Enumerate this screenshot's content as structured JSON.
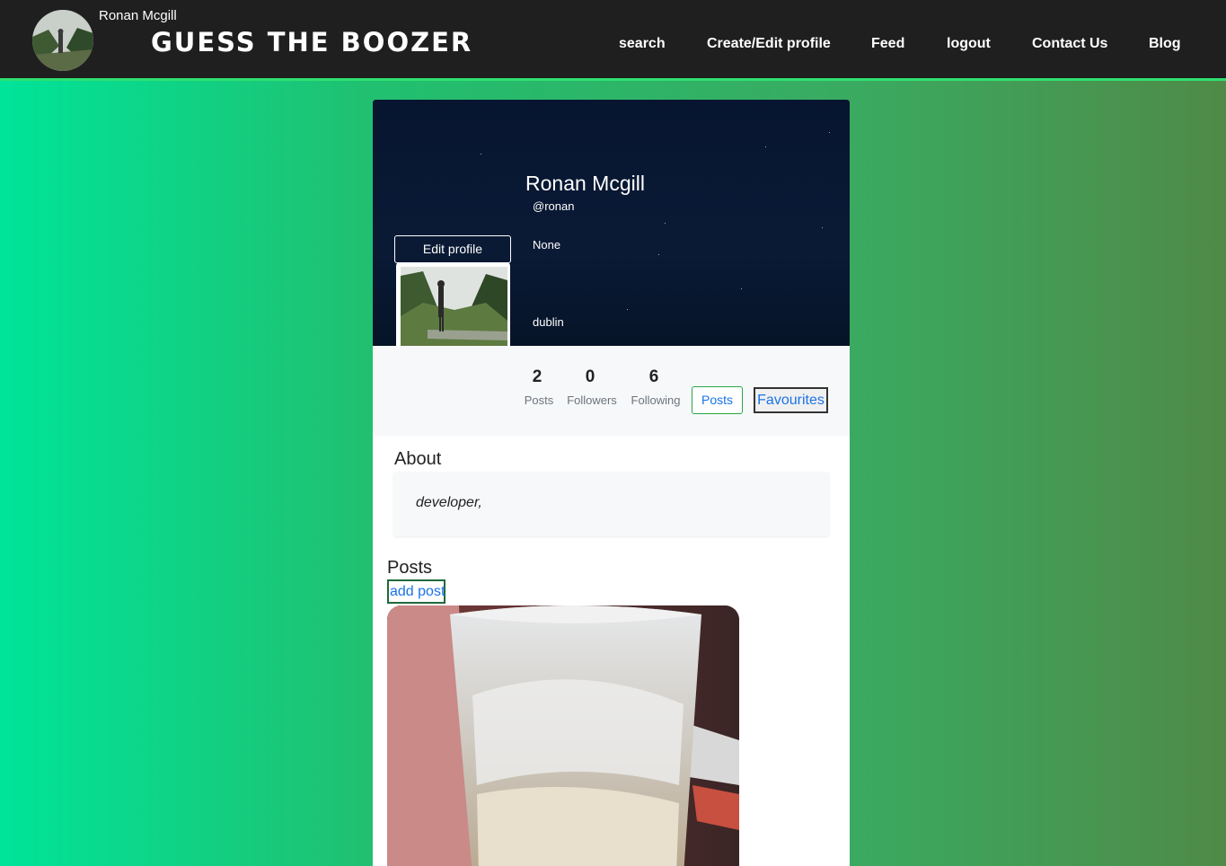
{
  "header": {
    "user_name": "Ronan Mcgill",
    "site_title": "GUESS THE BOOZER",
    "nav": [
      {
        "label": "search"
      },
      {
        "label": "Create/Edit profile"
      },
      {
        "label": "Feed"
      },
      {
        "label": "logout"
      },
      {
        "label": "Contact Us"
      },
      {
        "label": "Blog"
      }
    ]
  },
  "profile": {
    "name": "Ronan Mcgill",
    "handle": "@ronan",
    "status": "None",
    "location": "dublin",
    "edit_label": "Edit profile"
  },
  "stats": {
    "posts_count": "2",
    "posts_label": "Posts",
    "followers_count": "0",
    "followers_label": "Followers",
    "following_count": "6",
    "following_label": "Following"
  },
  "tabs": {
    "posts_label": "Posts",
    "favourites_label": "Favourites"
  },
  "about": {
    "title": "About",
    "text": "developer,"
  },
  "posts": {
    "title": "Posts",
    "add_label": "add post"
  },
  "colors": {
    "header_bg": "#1f1f1f",
    "header_border": "#2ee071",
    "link_blue": "#1a73e8",
    "outline_green": "#28a745"
  }
}
